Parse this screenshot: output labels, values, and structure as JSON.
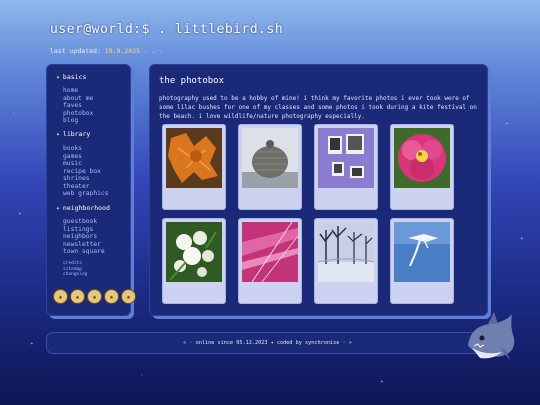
{
  "header": {
    "title": "user@world:$ . littlebird.sh",
    "updated_label": "last updated:",
    "updated_date": "19.9.2025",
    "updated_suffix": ". . ."
  },
  "sidebar": {
    "sections": [
      {
        "title": "basics",
        "links": [
          "home",
          "about me",
          "faves",
          "photobox",
          "blog"
        ]
      },
      {
        "title": "library",
        "links": [
          "books",
          "games",
          "music",
          "recipe box",
          "shrines",
          "theater",
          "web graphics"
        ]
      },
      {
        "title": "neighborhood",
        "links": [
          "guestbook",
          "listings",
          "neighbors",
          "newsletter",
          "town square"
        ]
      }
    ],
    "small_links": [
      "credits",
      "sitemap",
      "changelog"
    ]
  },
  "main": {
    "title": "the photobox",
    "intro": "photography used to be a hobby of mine! i think my favorite photos i ever took were of some lilac bushes for one of my classes and some photos i took during a kite festival on the beach. i love wildlife/nature photography especially."
  },
  "photos": [
    {
      "subject": "orange leaves"
    },
    {
      "subject": "grey knit hat"
    },
    {
      "subject": "purple photo frames"
    },
    {
      "subject": "pink cactus flower"
    },
    {
      "subject": "white lilac blossoms"
    },
    {
      "subject": "pink kite"
    },
    {
      "subject": "snowy trees"
    },
    {
      "subject": "bird kite in sky"
    }
  ],
  "footer": {
    "text": "« · online since 05.12.2023 ✦ coded by synchronise · »"
  },
  "colors": {
    "panel": "#1b2a78",
    "accent_link": "#a9b8ff",
    "date": "#ffd96a"
  },
  "icons": {
    "section_marker": "star-icon",
    "badge": "star-badge-icon",
    "mascot": "shark-icon"
  }
}
